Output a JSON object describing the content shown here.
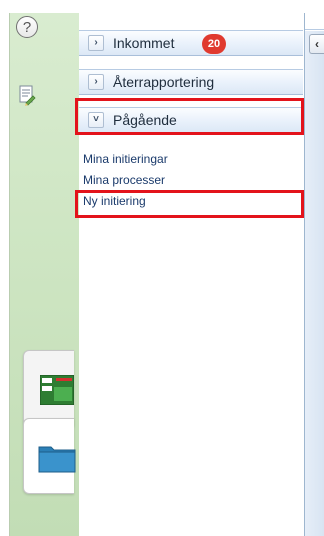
{
  "rail": {
    "help_icon": "question-circle-icon",
    "help_glyph": "?",
    "document_icon": "document-edit-icon",
    "tiles": [
      {
        "icon": "green-window-icon"
      },
      {
        "icon": "blue-folder-icon"
      }
    ]
  },
  "nav": {
    "sections": [
      {
        "label": "Inkommet",
        "badge": "20",
        "expanded": false,
        "toggle_glyph": "›"
      },
      {
        "label": "Återrapportering",
        "expanded": false,
        "toggle_glyph": "›"
      },
      {
        "label": "Pågående",
        "expanded": true,
        "toggle_glyph": "˅"
      }
    ],
    "links": [
      "Mina initieringar",
      "Mina processer",
      "Ny initiering"
    ]
  },
  "collapse_glyph": "‹",
  "colors": {
    "badge": "#e03a2f",
    "highlight": "#e3131b",
    "link": "#1a3a6b",
    "rail": "#cfe6c4"
  }
}
